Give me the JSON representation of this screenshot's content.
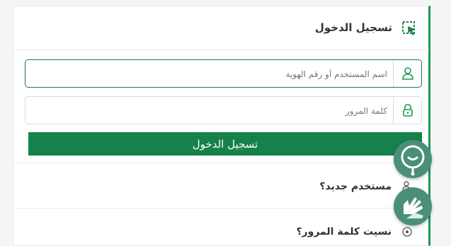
{
  "login": {
    "header_title": "تسجيل الدخول",
    "header_icon": "cursor-select-icon",
    "username_placeholder": "اسم المستخدم أو رقم الهوية",
    "password_placeholder": "كلمة المرور",
    "submit_label": "تسجيل الدخول"
  },
  "links": {
    "new_user": "مستخدم جديد؟",
    "forgot_password": "نسيت كلمة المرور؟"
  },
  "floating": {
    "chat_icon": "chat-support-icon",
    "sign_language_icon": "sign-language-icon"
  },
  "colors": {
    "accent": "#16814a",
    "floating_bg": "#4a8f7a"
  }
}
